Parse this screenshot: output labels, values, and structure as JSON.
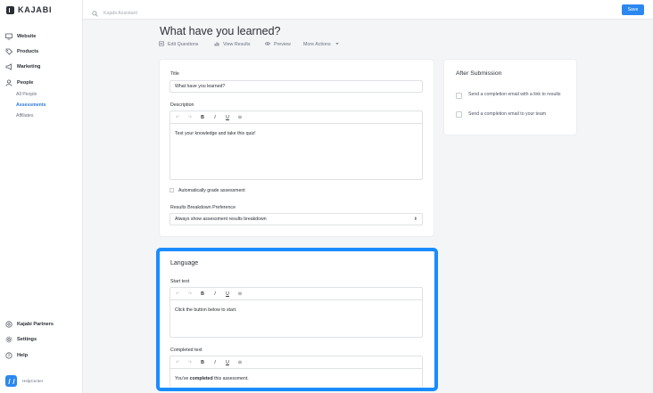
{
  "sidebar": {
    "logo": "KAJABI",
    "items": [
      {
        "label": "Website",
        "icon": "monitor-icon"
      },
      {
        "label": "Products",
        "icon": "tag-icon"
      },
      {
        "label": "Marketing",
        "icon": "megaphone-icon"
      },
      {
        "label": "People",
        "icon": "person-icon"
      }
    ],
    "sub_items": [
      {
        "label": "All People"
      },
      {
        "label": "Assessments"
      },
      {
        "label": "Affiliates"
      }
    ],
    "bottom_items": [
      {
        "label": "Kajabi Partners",
        "icon": "partners-icon"
      },
      {
        "label": "Settings",
        "icon": "gear-icon"
      },
      {
        "label": "Help",
        "icon": "help-icon"
      }
    ],
    "help_center": "HelpCenter"
  },
  "topbar": {
    "search_placeholder": "Kajabi Assistant",
    "save_label": "Save"
  },
  "header": {
    "title": "What have you learned?",
    "actions": [
      {
        "label": "Edit Questions",
        "icon": "edit-icon"
      },
      {
        "label": "View Results",
        "icon": "bar-chart-icon"
      },
      {
        "label": "Preview",
        "icon": "eye-icon"
      },
      {
        "label": "More Actions",
        "icon": "chevron-down-icon"
      }
    ]
  },
  "main_card": {
    "title_label": "Title",
    "title_value": "What have you learned?",
    "description_label": "Description",
    "description_value": "Test your knowledge and take this quiz!",
    "auto_grade_label": "Automatically grade assessment",
    "results_pref_label": "Results Breakdown Preference",
    "results_pref_value": "Always show assessment results breakdown"
  },
  "toolbar": {
    "undo": "↶",
    "redo": "↷",
    "bold": "B",
    "italic": "I",
    "underline": "U",
    "link": "⊝"
  },
  "after_submission": {
    "title": "After Submission",
    "option_1": "Send a completion email with a link to results",
    "option_2": "Send a completion email to your team"
  },
  "language_card": {
    "title": "Language",
    "start_label": "Start text",
    "start_value": "Click the button below to start.",
    "completed_label": "Completed text",
    "completed_prefix": "You've ",
    "completed_bold": "completed",
    "completed_suffix": " this assessment."
  },
  "colors": {
    "accent": "#2b88f0",
    "highlight": "#1a8cff",
    "active_nav": "#2b7bd8"
  }
}
